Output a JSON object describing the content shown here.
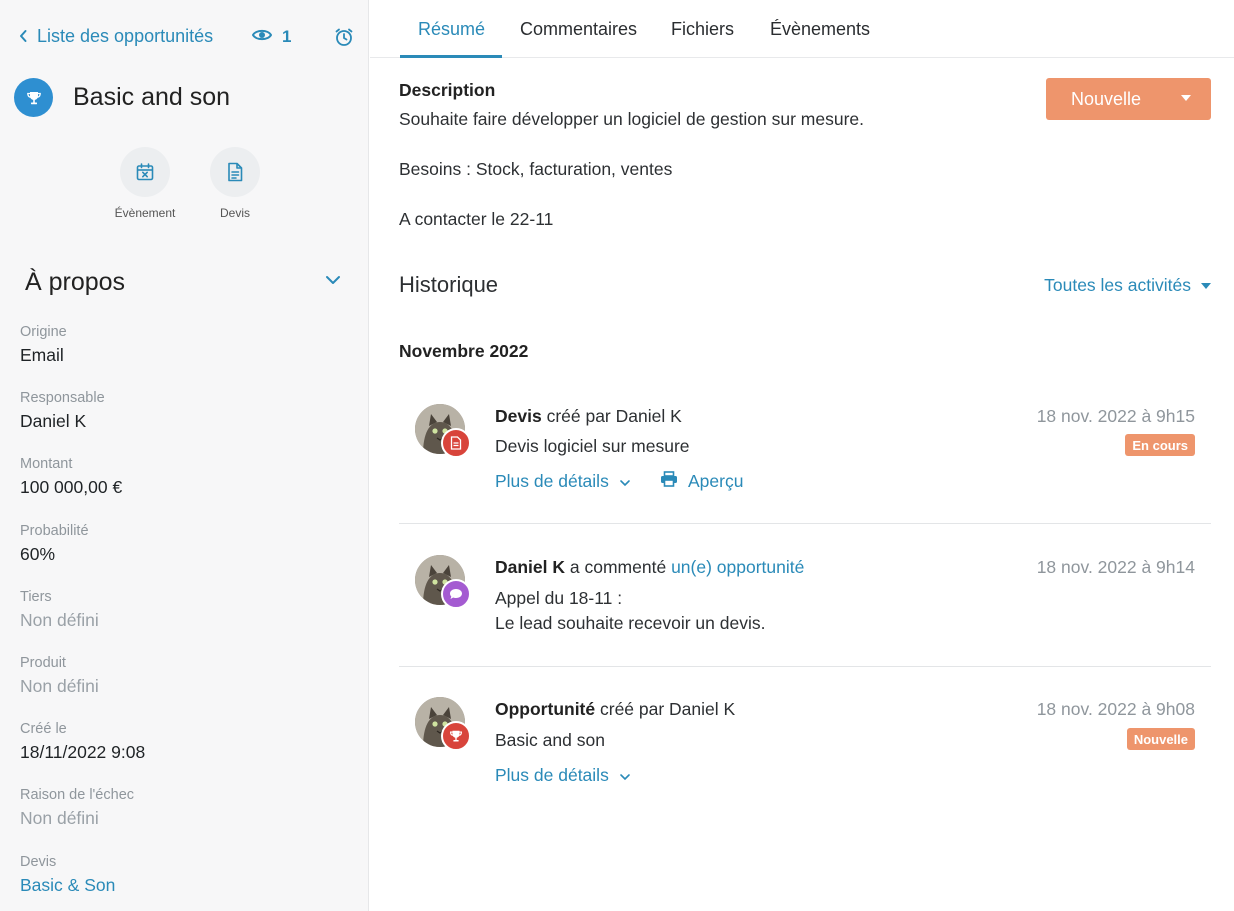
{
  "sidebar": {
    "back_label": "Liste des opportunités",
    "watchers_count": "1",
    "title": "Basic and son",
    "quick_actions": [
      {
        "label": "Évènement",
        "icon": "calendar-x-icon"
      },
      {
        "label": "Devis",
        "icon": "document-icon"
      }
    ],
    "about_title": "À propos",
    "fields": [
      {
        "label": "Origine",
        "value": "Email"
      },
      {
        "label": "Responsable",
        "value": "Daniel K"
      },
      {
        "label": "Montant",
        "value": "100 000,00 €"
      },
      {
        "label": "Probabilité",
        "value": "60%"
      },
      {
        "label": "Tiers",
        "value": "Non défini"
      },
      {
        "label": "Produit",
        "value": "Non défini"
      },
      {
        "label": "Créé le",
        "value": "18/11/2022 9:08"
      },
      {
        "label": "Raison de l'échec",
        "value": "Non défini"
      },
      {
        "label": "Devis",
        "value": "Basic & Son"
      }
    ]
  },
  "tabs": [
    {
      "label": "Résumé",
      "active": true
    },
    {
      "label": "Commentaires"
    },
    {
      "label": "Fichiers"
    },
    {
      "label": "Évènements"
    }
  ],
  "description": {
    "label": "Description",
    "lines": [
      "Souhaite faire développer un logiciel de gestion sur mesure.",
      "Besoins : Stock, facturation, ventes",
      "A contacter le 22-11"
    ]
  },
  "status_button": {
    "label": "Nouvelle"
  },
  "history": {
    "title": "Historique",
    "filter_label": "Toutes les activités",
    "month": "Novembre 2022",
    "entries": [
      {
        "title_bold": "Devis",
        "title_rest": " créé par Daniel K",
        "date": "18 nov. 2022 à 9h15",
        "text": "Devis logiciel sur mesure",
        "status": "En cours",
        "details_label": "Plus de détails",
        "preview_label": "Aperçu",
        "badge_icon": "document-icon",
        "badge_color": "#d8443b"
      },
      {
        "title_bold": "Daniel K",
        "title_rest": " a commenté ",
        "title_link": "un(e) opportunité",
        "date": "18 nov. 2022 à 9h14",
        "text_lines": [
          "Appel du 18-11 :",
          "Le lead souhaite recevoir un devis."
        ],
        "badge_icon": "comment-icon",
        "badge_color": "#a45bd1"
      },
      {
        "title_bold": "Opportunité",
        "title_rest": " créé par Daniel K",
        "date": "18 nov. 2022 à 9h08",
        "text": "Basic and son",
        "status": "Nouvelle",
        "details_label": "Plus de détails",
        "badge_icon": "trophy-icon",
        "badge_color": "#d8443b"
      }
    ]
  },
  "colors": {
    "accent": "#2a8ab8",
    "status_orange": "#ee956c",
    "trophy_blue": "#2e8fd1"
  }
}
